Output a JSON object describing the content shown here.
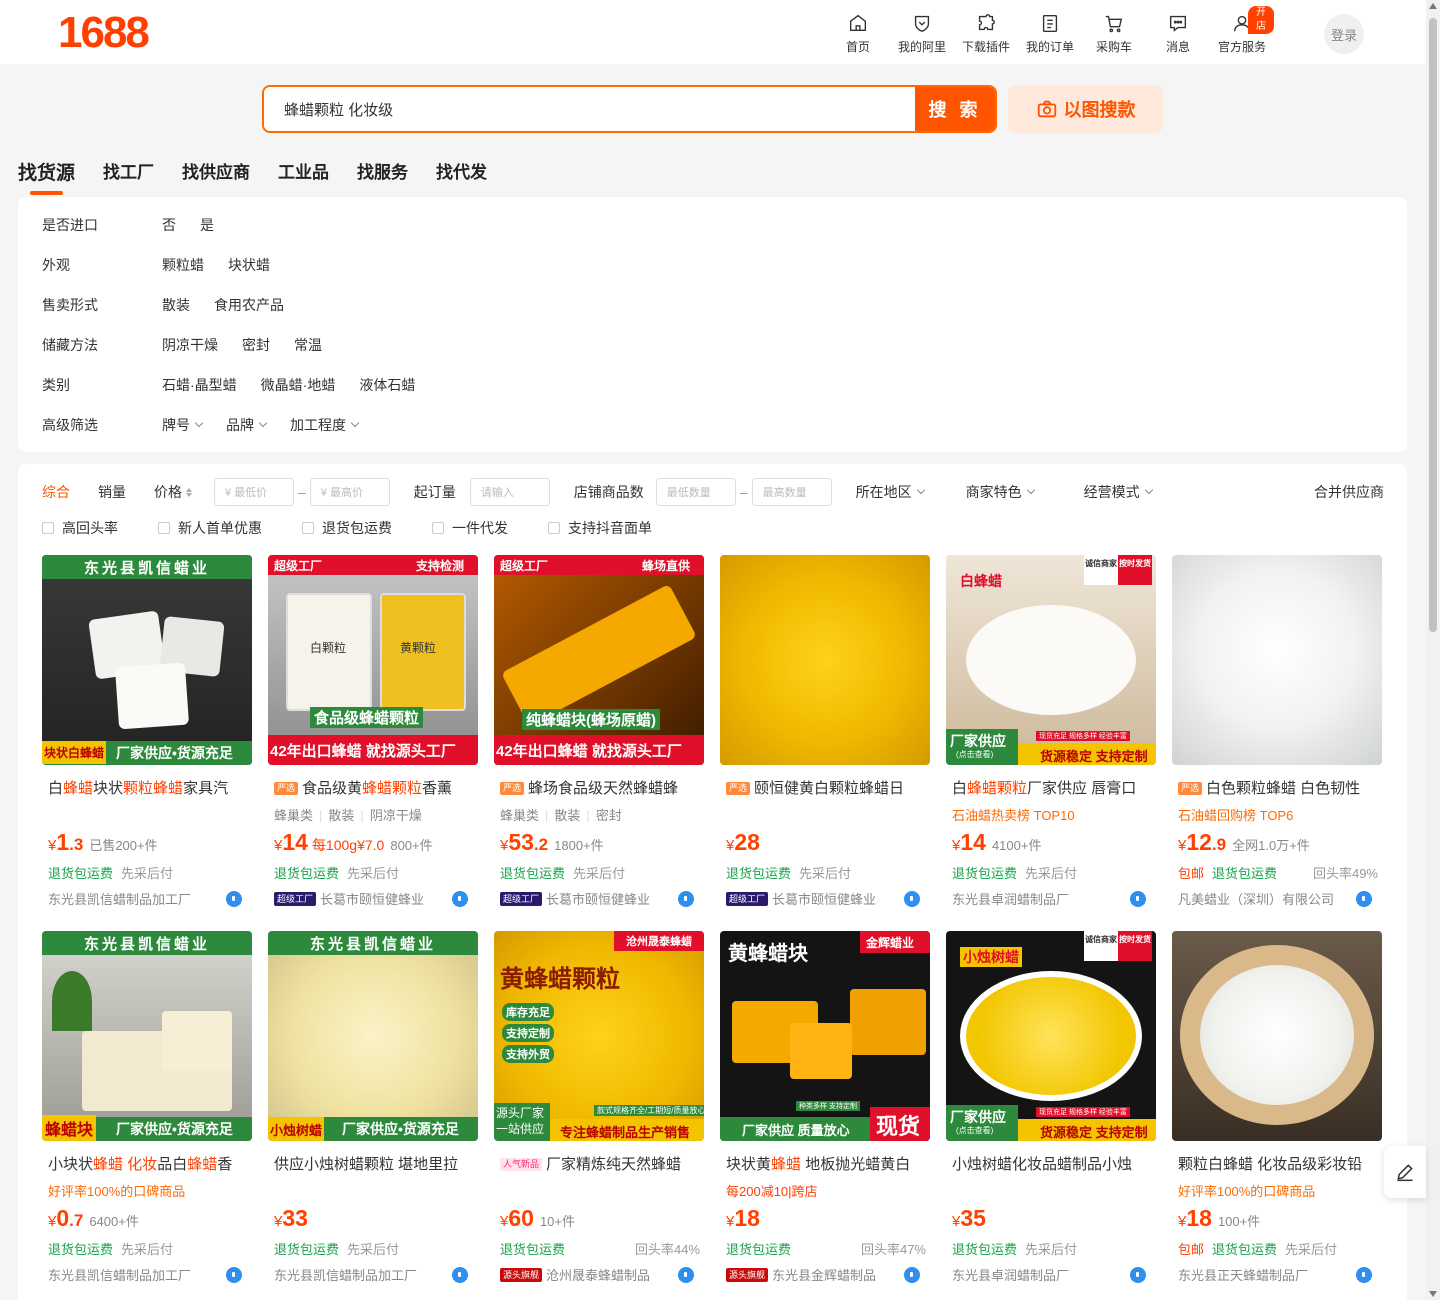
{
  "logo": "1688",
  "topnav": [
    {
      "label": "首页",
      "icon": "home-icon"
    },
    {
      "label": "我的阿里",
      "icon": "my-ali-icon"
    },
    {
      "label": "下载插件",
      "icon": "plugin-icon"
    },
    {
      "label": "我的订单",
      "icon": "order-icon"
    },
    {
      "label": "采购车",
      "icon": "cart-icon"
    },
    {
      "label": "消息",
      "icon": "message-icon"
    },
    {
      "label": "官方服务",
      "icon": "service-icon",
      "badge": "开店"
    }
  ],
  "login_label": "登录",
  "search": {
    "value": "蜂蜡颗粒 化妆级",
    "button": "搜 索",
    "image_search": "以图搜款"
  },
  "tabs": [
    "找货源",
    "找工厂",
    "找供应商",
    "工业品",
    "找服务",
    "找代发"
  ],
  "filters": [
    {
      "key": "是否进口",
      "values": [
        "否",
        "是"
      ]
    },
    {
      "key": "外观",
      "values": [
        "颗粒蜡",
        "块状蜡"
      ]
    },
    {
      "key": "售卖形式",
      "values": [
        "散装",
        "食用农产品"
      ]
    },
    {
      "key": "储藏方法",
      "values": [
        "阴凉干燥",
        "密封",
        "常温"
      ]
    },
    {
      "key": "类别",
      "values": [
        "石蜡·晶型蜡",
        "微晶蜡·地蜡",
        "液体石蜡"
      ]
    },
    {
      "key": "高级筛选",
      "values": [
        "牌号",
        "品牌",
        "加工程度"
      ]
    }
  ],
  "sortbar": {
    "comprehensive": "综合",
    "sales": "销量",
    "price": "价格",
    "min_price": "¥ 最低价",
    "max_price": "¥ 最高价",
    "moq": "起订量",
    "moq_placeholder": "请输入",
    "shop_count": "店铺商品数",
    "min_count": "最低数量",
    "max_count": "最高数量",
    "region": "所在地区",
    "merchant": "商家特色",
    "mode": "经营模式",
    "merge": "合并供应商"
  },
  "checks": [
    "高回头率",
    "新人首单优惠",
    "退货包运费",
    "一件代发",
    "支持抖音面单"
  ],
  "colors": {
    "accent": "#ff5500",
    "price": "#ff4000",
    "green": "#16a34a"
  },
  "products": [
    {
      "img_top": "东光县凯信蜡业",
      "img_bottom": "块状白蜂蜡",
      "img_bottom2": "厂家供应•货源充足",
      "tag": "",
      "t1": "白",
      "h1": "蜂蜡",
      "t2": "块状",
      "h2": "颗粒蜂蜡",
      "t3": "家具汽",
      "sub": "",
      "rank": "",
      "price_int": "1",
      "price_dec": ".3",
      "unit": "",
      "sold": "已售200+件",
      "svc": [
        "退货包运费",
        "先采后付"
      ],
      "svc_red": "",
      "rep": "",
      "shop_badge": "",
      "shop": "东光县凯信蜡制品加工厂"
    },
    {
      "img_top": "超级工厂",
      "img_top2": "支持检测",
      "img_mid": "白颗粒",
      "img_mid2": "黄颗粒",
      "img_label": "食品级蜂蜡颗粒",
      "img_bottom": "42年出口蜂蜡 就找源头工厂",
      "tag": "严选",
      "t1": "食品级黄",
      "h1": "蜂蜡颗粒",
      "t2": "香薰",
      "h2": "",
      "t3": "",
      "sub": [
        "蜂巢类",
        "散装",
        "阴凉干燥"
      ],
      "rank": "",
      "price_int": "14",
      "price_dec": "",
      "unit": "每100g¥7.0",
      "sold": "800+件",
      "svc": [
        "退货包运费",
        "先采后付"
      ],
      "svc_red": "",
      "rep": "",
      "shop_badge": "超级工厂",
      "shop": "长葛市颐恒健蜂业"
    },
    {
      "img_top": "超级工厂",
      "img_top2": "蜂场直供",
      "img_label": "纯蜂蜡块(蜂场原蜡)",
      "img_bottom": "42年出口蜂蜡 就找源头工厂",
      "tag": "严选",
      "t1": "蜂场食品级天然蜂蜡蜂",
      "h1": "",
      "t2": "",
      "h2": "",
      "t3": "",
      "sub": [
        "蜂巢类",
        "散装",
        "密封"
      ],
      "rank": "",
      "price_int": "53",
      "price_dec": ".2",
      "unit": "",
      "sold": "1800+件",
      "svc": [
        "退货包运费",
        "先采后付"
      ],
      "svc_red": "",
      "rep": "",
      "shop_badge": "超级工厂",
      "shop": "长葛市颐恒健蜂业"
    },
    {
      "tag": "严选",
      "t1": "颐恒健黄白颗粒蜂蜡日",
      "h1": "",
      "t2": "",
      "h2": "",
      "t3": "",
      "sub": "",
      "rank": "",
      "price_int": "28",
      "price_dec": "",
      "unit": "",
      "sold": "",
      "svc": [
        "退货包运费",
        "先采后付"
      ],
      "svc_red": "",
      "rep": "",
      "shop_badge": "超级工厂",
      "shop": "长葛市颐恒健蜂业"
    },
    {
      "img_top": "白蜂蜡",
      "img_corner1": "诚信商家",
      "img_corner2": "按时发货",
      "img_bottom": "厂家供应",
      "img_bottom_sub": "(点击查看)",
      "img_bottom2": "货源稳定 支持定制",
      "img_ribbon": "现货充足 规格多样 经验丰富",
      "tag": "",
      "t1": "白",
      "h1": "蜂蜡颗粒",
      "t2": "厂家供应 唇膏口",
      "h2": "",
      "t3": "",
      "sub": "",
      "rank": "石油蜡热卖榜 TOP10",
      "price_int": "14",
      "price_dec": "",
      "unit": "",
      "sold": "4100+件",
      "svc": [
        "退货包运费",
        "先采后付"
      ],
      "svc_red": "",
      "rep": "",
      "shop_badge": "",
      "shop": "东光县卓润蜡制品厂"
    },
    {
      "tag": "严选",
      "t1": "白色颗粒蜂蜡 白色韧性",
      "h1": "",
      "t2": "",
      "h2": "",
      "t3": "",
      "sub": "",
      "rank": "石油蜡回购榜 TOP6",
      "price_int": "12",
      "price_dec": ".9",
      "unit": "",
      "sold": "全网1.0万+件",
      "svc": [
        "退货包运费"
      ],
      "svc_red": "包邮",
      "rep": "回头率49%",
      "shop_badge": "",
      "shop": "凡美蜡业（深圳）有限公司"
    },
    {
      "img_top": "东光县凯信蜡业",
      "img_bottom": "蜂蜡块",
      "img_bottom2": "厂家供应•货源充足",
      "tag": "",
      "t1": "小块状",
      "h1": "蜂蜡 化妆",
      "t2": "品白",
      "h2": "蜂蜡",
      "t3": "香",
      "sub": "",
      "rank": "好评率100%的口碑商品",
      "price_int": "0",
      "price_dec": ".7",
      "unit": "",
      "sold": "6400+件",
      "svc": [
        "退货包运费",
        "先采后付"
      ],
      "svc_red": "",
      "rep": "",
      "shop_badge": "",
      "shop": "东光县凯信蜡制品加工厂"
    },
    {
      "img_top": "东光县凯信蜡业",
      "img_bottom": "小烛树蜡",
      "img_bottom2": "厂家供应•货源充足",
      "tag": "",
      "t1": "供应小烛树蜡颗粒 堪地里拉",
      "h1": "",
      "t2": "",
      "h2": "",
      "t3": "",
      "sub": "",
      "rank": "",
      "price_int": "33",
      "price_dec": "",
      "unit": "",
      "sold": "",
      "svc": [
        "退货包运费",
        "先采后付"
      ],
      "svc_red": "",
      "rep": "",
      "shop_badge": "",
      "shop": "东光县凯信蜡制品加工厂"
    },
    {
      "img_top": "沧州晟泰蜂蜡",
      "img_label": "黄蜂蜡颗粒",
      "img_checks": [
        "库存充足",
        "支持定制",
        "支持外贸"
      ],
      "img_small": "款式规格齐全/工期短/质量放心",
      "img_bottom": "源头厂家 一站供应",
      "img_bottom2": "专注蜂蜡制品生产销售",
      "tag": "人气新品",
      "t1": "厂家精炼纯天然蜂蜡",
      "h1": "",
      "t2": "",
      "h2": "",
      "t3": "",
      "sub": "",
      "rank": "",
      "price_int": "60",
      "price_dec": "",
      "unit": "",
      "sold": "10+件",
      "svc": [
        "退货包运费"
      ],
      "svc_red": "",
      "rep": "回头率44%",
      "shop_badge": "源头旗舰",
      "shop": "沧州晟泰蜂蜡制品"
    },
    {
      "img_top": "黄蜂蜡块",
      "img_top2": "金辉蜡业",
      "img_ribbon": "种类多样 支持定制",
      "img_bottom": "厂家供应 质量放心",
      "img_bottom2": "现货",
      "tag": "",
      "t1": "块状黄",
      "h1": "蜂蜡",
      "t2": " 地板抛光蜡黄白",
      "h2": "",
      "t3": "",
      "sub": "",
      "rank": "每200减10|跨店",
      "price_int": "18",
      "price_dec": "",
      "unit": "",
      "sold": "",
      "svc": [
        "退货包运费"
      ],
      "svc_red": "",
      "rep": "回头率47%",
      "shop_badge": "源头旗舰",
      "shop": "东光县金辉蜡制品"
    },
    {
      "img_top": "小烛树蜡",
      "img_corner1": "诚信商家",
      "img_corner2": "按时发货",
      "img_bottom": "厂家供应",
      "img_bottom_sub": "(点击查看)",
      "img_bottom2": "货源稳定 支持定制",
      "img_ribbon": "现货充足 规格多样 经验丰富",
      "tag": "",
      "t1": "小烛树蜡化妆品蜡制品小烛",
      "h1": "",
      "t2": "",
      "h2": "",
      "t3": "",
      "sub": "",
      "rank": "",
      "price_int": "35",
      "price_dec": "",
      "unit": "",
      "sold": "",
      "svc": [
        "退货包运费",
        "先采后付"
      ],
      "svc_red": "",
      "rep": "",
      "shop_badge": "",
      "shop": "东光县卓润蜡制品厂"
    },
    {
      "tag": "",
      "t1": "颗粒白蜂蜡 化妆品级彩妆铅",
      "h1": "",
      "t2": "",
      "h2": "",
      "t3": "",
      "sub": "",
      "rank": "好评率100%的口碑商品",
      "price_int": "18",
      "price_dec": "",
      "unit": "",
      "sold": "100+件",
      "svc": [
        "退货包运费",
        "先采后付"
      ],
      "svc_red": "包邮",
      "rep": "",
      "shop_badge": "",
      "shop": "东光县正天蜂蜡制品厂"
    }
  ]
}
